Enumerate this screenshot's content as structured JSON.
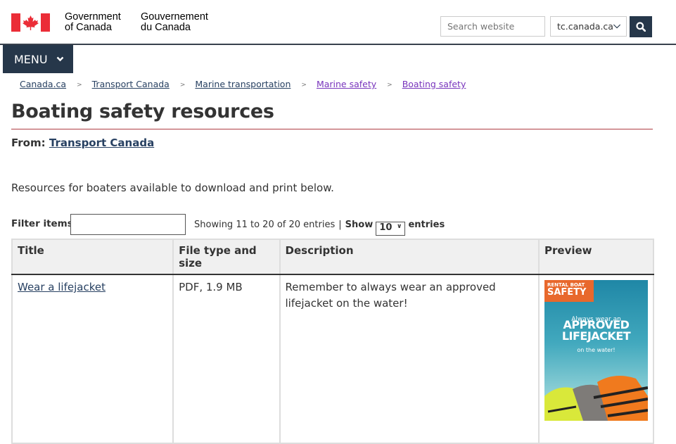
{
  "header": {
    "signature_en": [
      "Government",
      "of Canada"
    ],
    "signature_fr": [
      "Gouvernement",
      "du Canada"
    ],
    "search_placeholder": "Search website",
    "site_select_value": "tc.canada.ca",
    "search_button_icon": "search-icon",
    "brand_color": "#26374a",
    "flag_red": "#eb2d37"
  },
  "menu": {
    "label": "MENU",
    "icon": "chevron-down-icon"
  },
  "breadcrumb": [
    {
      "label": "Canada.ca",
      "visited": false
    },
    {
      "label": "Transport Canada",
      "visited": false
    },
    {
      "label": "Marine transportation",
      "visited": false
    },
    {
      "label": "Marine safety",
      "visited": true
    },
    {
      "label": "Boating safety",
      "visited": true
    }
  ],
  "page": {
    "title": "Boating safety resources",
    "from_label": "From:",
    "from_link": "Transport Canada",
    "intro": "Resources for boaters available to download and print below."
  },
  "table_controls": {
    "filter_label": "Filter items",
    "filter_value": "",
    "showing": "Showing 11 to 20 of 20 entries",
    "show_label": "Show",
    "page_size": "10",
    "entries_label": "entries"
  },
  "table": {
    "headers": [
      "Title",
      "File type and size",
      "Description",
      "Preview"
    ],
    "rows": [
      {
        "title": "Wear a lifejacket",
        "file": "PDF, 1.9 MB",
        "description": "Remember to always wear an approved lifejacket on the water!",
        "preview": {
          "tag_small": "RENTAL BOAT",
          "tag_large": "SAFETY",
          "line1": "Always wear an",
          "line2": "APPROVED",
          "line2b": "LIFEJACKET",
          "line3": "on the water!"
        }
      }
    ]
  }
}
